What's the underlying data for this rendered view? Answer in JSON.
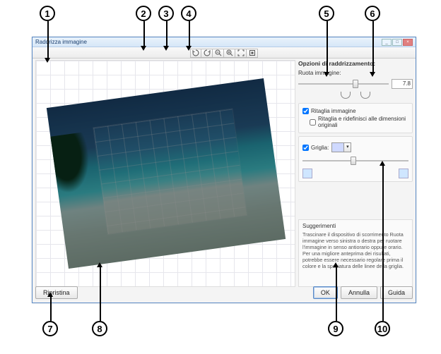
{
  "window": {
    "title": "Raddrizza immagine",
    "buttons": {
      "min": "_",
      "max": "□",
      "close": "×"
    }
  },
  "toolbar": {
    "rotate_ccw": "rotate-ccw",
    "rotate_cw": "rotate-cw",
    "zoom_out": "zoom-out",
    "zoom_in": "zoom-in",
    "fit": "fit-screen",
    "actual": "actual-pixels"
  },
  "panel": {
    "title": "Opzioni di raddrizzamento:",
    "rotate_label": "Ruota immagine:",
    "rotate_value": "7.8",
    "crop_checkbox": "Ritaglia immagine",
    "crop_original": "Ritaglia e ridefinisci alle dimensioni originali",
    "grid_checkbox": "Griglia:",
    "grid_color": "#cfd9ff"
  },
  "tips": {
    "title": "Suggerimenti",
    "body": "Trascinare il dispositivo di scorrimento Ruota immagine verso sinistra o destra per ruotare l'immagine in senso antiorario oppure orario. Per una migliore anteprima dei risultati, potrebbe essere necessario regolare prima il colore e la spaziatura delle linee della griglia."
  },
  "buttons": {
    "reset": "Ripristina",
    "ok": "OK",
    "cancel": "Annulla",
    "help": "Guida"
  },
  "callouts": [
    "1",
    "2",
    "3",
    "4",
    "5",
    "6",
    "7",
    "8",
    "9",
    "10"
  ]
}
